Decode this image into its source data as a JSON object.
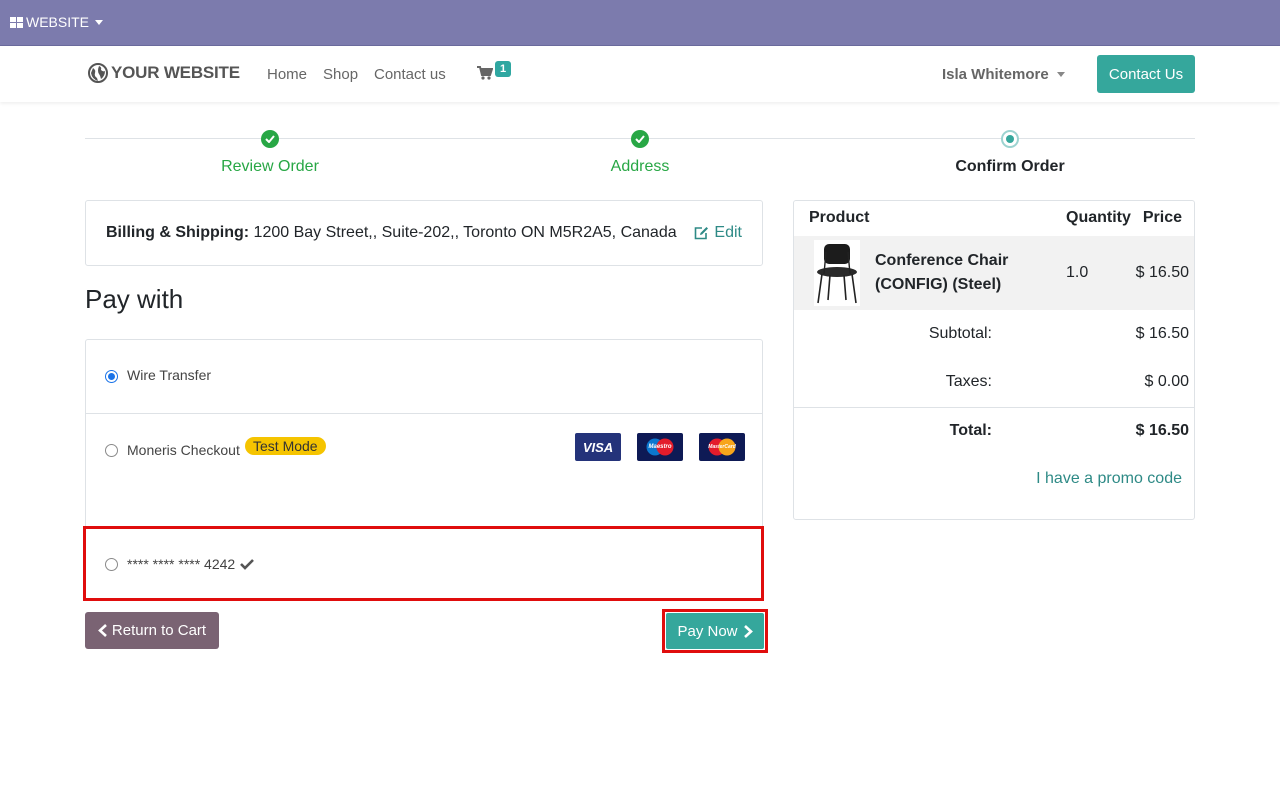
{
  "topbar": {
    "menu_label": "WEBSITE"
  },
  "navbar": {
    "logo_text": "YOUR WEBSITE",
    "links": [
      "Home",
      "Shop",
      "Contact us"
    ],
    "cart_count": "1",
    "user_name": "Isla Whitemore",
    "contact_button": "Contact Us"
  },
  "progress": {
    "steps": [
      {
        "label": "Review Order",
        "state": "done"
      },
      {
        "label": "Address",
        "state": "done"
      },
      {
        "label": "Confirm Order",
        "state": "current"
      }
    ]
  },
  "billing": {
    "label": "Billing & Shipping:",
    "address": "1200 Bay Street,, Suite-202,, Toronto ON M5R2A5, Canada",
    "edit_label": "Edit"
  },
  "payment": {
    "title": "Pay with",
    "methods": [
      {
        "label": "Wire Transfer",
        "selected": true
      },
      {
        "label": "Moneris Checkout",
        "badge": "Test Mode",
        "selected": false
      },
      {
        "label": "**** **** **** 4242",
        "selected": false
      }
    ],
    "card_logos": [
      "VISA",
      "Maestro",
      "MasterCard"
    ]
  },
  "buttons": {
    "return_label": "Return to Cart",
    "pay_label": "Pay Now"
  },
  "summary": {
    "headers": {
      "product": "Product",
      "quantity": "Quantity",
      "price": "Price"
    },
    "item": {
      "name_line1": "Conference Chair",
      "name_line2": "(CONFIG) (Steel)",
      "quantity": "1.0",
      "price": "$ 16.50"
    },
    "subtotal_label": "Subtotal:",
    "subtotal_value": "$ 16.50",
    "taxes_label": "Taxes:",
    "taxes_value": "$ 0.00",
    "total_label": "Total:",
    "total_value": "$ 16.50",
    "promo_label": "I have a promo code"
  },
  "colors": {
    "topbar": "#7c7bad",
    "primary": "#35a79c",
    "success": "#28a745",
    "secondary": "#7a6373",
    "highlight": "#e00d0d",
    "badge": "#f5c400"
  }
}
